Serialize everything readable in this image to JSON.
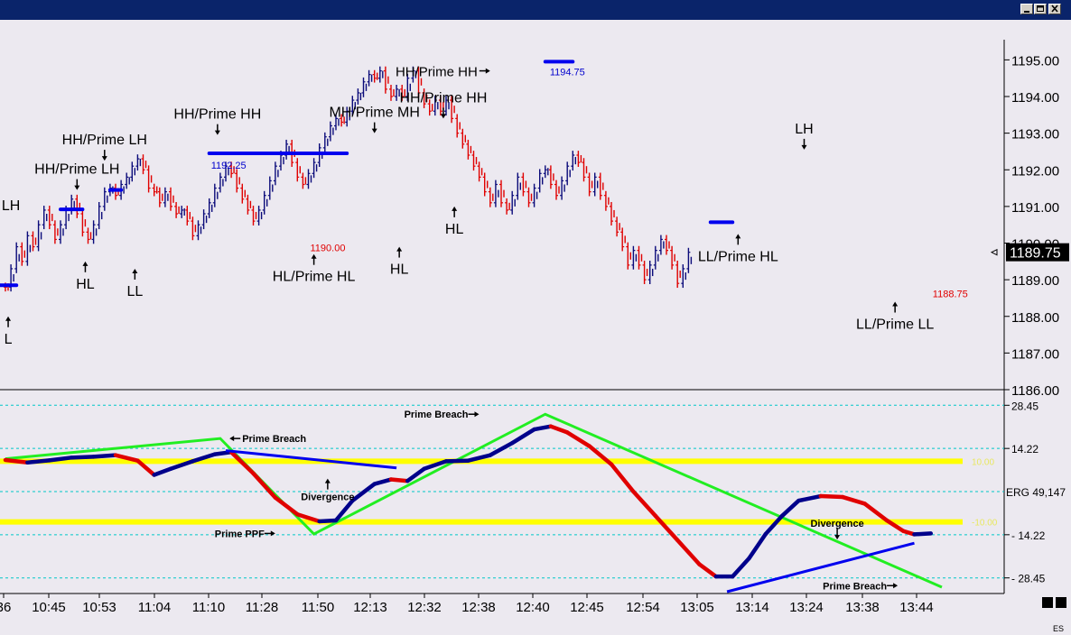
{
  "window": {
    "buttons": [
      "minimize",
      "maximize",
      "close"
    ]
  },
  "colors": {
    "background": "#ece9f0",
    "up_bar": "#0b0b7a",
    "down_bar": "#e00000",
    "level_bar": "#0000ee",
    "prime_line": "#22ee22",
    "reference_line": "#ffff00",
    "grid": "#00c8c8",
    "erg_up": "#00008b",
    "erg_down": "#e00000"
  },
  "chart_data": [
    {
      "type": "bar",
      "panel": "price",
      "symbol": "ES",
      "price_axis": {
        "ticks": [
          "1195.00",
          "1194.00",
          "1193.00",
          "1192.00",
          "1191.00",
          "1190.00",
          "1189.00",
          "1188.00",
          "1187.00",
          "1186.00"
        ],
        "range": [
          1186.0,
          1195.6
        ],
        "current_price": "1189.75"
      },
      "time_axis": {
        "ticks": [
          "36",
          "10:45",
          "10:53",
          "11:04",
          "11:10",
          "11:28",
          "11:50",
          "12:13",
          "12:32",
          "12:38",
          "12:40",
          "12:45",
          "12:54",
          "13:05",
          "13:14",
          "13:24",
          "13:38",
          "13:44"
        ]
      },
      "price_path": [
        [
          0,
          1188.8,
          -1
        ],
        [
          1,
          1189.3,
          1
        ],
        [
          2,
          1189.9,
          1
        ],
        [
          3,
          1189.5,
          -1
        ],
        [
          4,
          1190.2,
          1
        ],
        [
          5,
          1189.9,
          -1
        ],
        [
          6,
          1190.5,
          1
        ],
        [
          7,
          1190.9,
          1
        ],
        [
          8,
          1190.5,
          -1
        ],
        [
          9,
          1190.1,
          -1
        ],
        [
          10,
          1190.5,
          1
        ],
        [
          11,
          1190.9,
          1
        ],
        [
          12,
          1191.2,
          1
        ],
        [
          13,
          1190.8,
          -1
        ],
        [
          14,
          1190.3,
          -1
        ],
        [
          15,
          1190.1,
          -1
        ],
        [
          16,
          1190.5,
          1
        ],
        [
          17,
          1191.0,
          1
        ],
        [
          18,
          1191.4,
          1
        ],
        [
          19,
          1191.5,
          1
        ],
        [
          20,
          1191.3,
          -1
        ],
        [
          21,
          1191.6,
          1
        ],
        [
          22,
          1191.8,
          1
        ],
        [
          23,
          1192.1,
          1
        ],
        [
          24,
          1192.3,
          1
        ],
        [
          25,
          1192.0,
          -1
        ],
        [
          26,
          1191.5,
          -1
        ],
        [
          27,
          1191.4,
          -1
        ],
        [
          28,
          1191.1,
          -1
        ],
        [
          29,
          1191.4,
          1
        ],
        [
          30,
          1191.0,
          -1
        ],
        [
          31,
          1190.8,
          -1
        ],
        [
          32,
          1190.9,
          1
        ],
        [
          33,
          1190.6,
          -1
        ],
        [
          34,
          1190.2,
          -1
        ],
        [
          35,
          1190.5,
          1
        ],
        [
          36,
          1190.8,
          1
        ],
        [
          37,
          1191.1,
          1
        ],
        [
          38,
          1191.5,
          1
        ],
        [
          39,
          1191.8,
          1
        ],
        [
          40,
          1192.1,
          1
        ],
        [
          41,
          1191.9,
          -1
        ],
        [
          42,
          1191.5,
          -1
        ],
        [
          43,
          1191.2,
          -1
        ],
        [
          44,
          1190.9,
          -1
        ],
        [
          45,
          1190.6,
          -1
        ],
        [
          46,
          1190.9,
          1
        ],
        [
          47,
          1191.3,
          1
        ],
        [
          48,
          1191.7,
          1
        ],
        [
          49,
          1192.1,
          1
        ],
        [
          50,
          1192.4,
          1
        ],
        [
          51,
          1192.7,
          1
        ],
        [
          52,
          1192.2,
          -1
        ],
        [
          53,
          1191.8,
          -1
        ],
        [
          54,
          1191.6,
          -1
        ],
        [
          55,
          1191.9,
          1
        ],
        [
          56,
          1192.2,
          1
        ],
        [
          57,
          1192.6,
          1
        ],
        [
          58,
          1192.9,
          1
        ],
        [
          59,
          1193.2,
          1
        ],
        [
          60,
          1193.4,
          1
        ],
        [
          61,
          1193.3,
          -1
        ],
        [
          62,
          1193.6,
          1
        ],
        [
          63,
          1193.9,
          1
        ],
        [
          64,
          1194.1,
          1
        ],
        [
          65,
          1194.4,
          1
        ],
        [
          66,
          1194.6,
          1
        ],
        [
          67,
          1194.5,
          -1
        ],
        [
          68,
          1194.7,
          1
        ],
        [
          69,
          1194.2,
          -1
        ],
        [
          70,
          1194.0,
          -1
        ],
        [
          71,
          1194.2,
          1
        ],
        [
          72,
          1194.0,
          -1
        ],
        [
          73,
          1194.5,
          1
        ],
        [
          74,
          1194.7,
          1
        ],
        [
          75,
          1194.1,
          -1
        ],
        [
          76,
          1193.8,
          -1
        ],
        [
          77,
          1193.6,
          -1
        ],
        [
          78,
          1193.9,
          1
        ],
        [
          79,
          1193.6,
          -1
        ],
        [
          80,
          1193.9,
          1
        ],
        [
          81,
          1193.4,
          -1
        ],
        [
          82,
          1193.0,
          -1
        ],
        [
          83,
          1192.7,
          -1
        ],
        [
          84,
          1192.4,
          -1
        ],
        [
          85,
          1192.1,
          -1
        ],
        [
          86,
          1191.8,
          -1
        ],
        [
          87,
          1191.4,
          -1
        ],
        [
          88,
          1191.1,
          -1
        ],
        [
          89,
          1191.6,
          1
        ],
        [
          90,
          1191.1,
          -1
        ],
        [
          91,
          1190.9,
          -1
        ],
        [
          92,
          1191.3,
          1
        ],
        [
          93,
          1191.8,
          1
        ],
        [
          94,
          1191.4,
          -1
        ],
        [
          95,
          1191.1,
          -1
        ],
        [
          96,
          1191.5,
          1
        ],
        [
          97,
          1191.9,
          1
        ],
        [
          98,
          1192.0,
          1
        ],
        [
          99,
          1191.6,
          -1
        ],
        [
          100,
          1191.3,
          -1
        ],
        [
          101,
          1191.7,
          1
        ],
        [
          102,
          1192.1,
          1
        ],
        [
          103,
          1192.4,
          1
        ],
        [
          104,
          1192.2,
          -1
        ],
        [
          105,
          1191.8,
          -1
        ],
        [
          106,
          1191.4,
          -1
        ],
        [
          107,
          1191.8,
          1
        ],
        [
          108,
          1191.3,
          -1
        ],
        [
          109,
          1191.0,
          -1
        ],
        [
          110,
          1190.6,
          -1
        ],
        [
          111,
          1190.3,
          -1
        ],
        [
          112,
          1189.9,
          -1
        ],
        [
          113,
          1189.4,
          -1
        ],
        [
          114,
          1189.8,
          1
        ],
        [
          115,
          1189.4,
          -1
        ],
        [
          116,
          1189.0,
          -1
        ],
        [
          117,
          1189.4,
          1
        ],
        [
          118,
          1189.8,
          1
        ],
        [
          119,
          1190.1,
          1
        ],
        [
          120,
          1189.8,
          -1
        ],
        [
          121,
          1189.4,
          -1
        ],
        [
          122,
          1188.9,
          -1
        ],
        [
          123,
          1189.3,
          1
        ],
        [
          124,
          1189.75,
          1
        ]
      ],
      "levels": [
        {
          "x0": -2,
          "x1": 2,
          "price": 1188.85
        },
        {
          "x0": 10,
          "x1": 14,
          "price": 1190.92
        },
        {
          "x0": 19,
          "x1": 21,
          "price": 1191.45
        },
        {
          "x0": 37,
          "x1": 62,
          "price": 1192.45
        },
        {
          "x0": 98,
          "x1": 103,
          "price": 1194.95
        },
        {
          "x0": 128,
          "x1": 132,
          "price": 1190.57
        }
      ],
      "price_labels": [
        {
          "text": "1192.25",
          "bar": 37,
          "price": 1192.15,
          "color": "#0000cc"
        },
        {
          "text": "1190.00",
          "bar": 55,
          "price": 1189.9,
          "color": "#e00000"
        },
        {
          "text": "1194.75",
          "bar": 98.5,
          "price": 1194.7,
          "color": "#0000cc"
        },
        {
          "text": "1188.75",
          "bar": 168,
          "price": 1188.65,
          "color": "#e00000"
        }
      ],
      "annotations": [
        {
          "text": "LH",
          "bar": 1,
          "price": 1191.05,
          "arrow": "none"
        },
        {
          "text": "L",
          "bar": 0.5,
          "price": 1188.0,
          "arrow": "up"
        },
        {
          "text": "HH/Prime LH",
          "bar": 13,
          "price": 1191.45,
          "arrow": "down"
        },
        {
          "text": "HH/Prime LH",
          "bar": 18,
          "price": 1192.25,
          "arrow": "down"
        },
        {
          "text": "HL",
          "bar": 14.5,
          "price": 1189.5,
          "arrow": "up"
        },
        {
          "text": "LL",
          "bar": 23.5,
          "price": 1189.3,
          "arrow": "up"
        },
        {
          "text": "HH/Prime HH",
          "bar": 38.5,
          "price": 1192.95,
          "arrow": "down"
        },
        {
          "text": "HL/Prime HL",
          "bar": 56,
          "price": 1189.7,
          "arrow": "up"
        },
        {
          "text": "MH/Prime MH",
          "bar": 67,
          "price": 1193.0,
          "arrow": "down"
        },
        {
          "text": "HL",
          "bar": 71.5,
          "price": 1189.9,
          "arrow": "up"
        },
        {
          "text": "HH/Prime HH",
          "bar": 79.5,
          "price": 1193.4,
          "arrow": "down"
        },
        {
          "text": "HL",
          "bar": 81.5,
          "price": 1191.0,
          "arrow": "up"
        },
        {
          "text": "HH/Prime HH",
          "bar": 88,
          "price": 1194.7,
          "arrow": "right"
        },
        {
          "text": "LH",
          "bar": 145,
          "price": 1192.55,
          "arrow": "down"
        },
        {
          "text": "LL/Prime HL",
          "bar": 133,
          "price": 1190.25,
          "arrow": "up"
        },
        {
          "text": "LL/Prime LL",
          "bar": 161.5,
          "price": 1188.4,
          "arrow": "up"
        }
      ]
    },
    {
      "type": "line",
      "panel": "ERG",
      "label": "ERG 49,147",
      "axis_ticks": [
        "28.45",
        "14.22",
        "- 14.22",
        "- 28.45"
      ],
      "range": [
        -33,
        33
      ],
      "reference_lines": [
        {
          "value": 10.0,
          "label": "10.00"
        },
        {
          "value": -10.0,
          "label": "-10.00"
        }
      ],
      "series": [
        {
          "values": [
            [
              0,
              10.4
            ],
            [
              4,
              9.6
            ],
            [
              8,
              10.3
            ],
            [
              12,
              11.2
            ],
            [
              16,
              11.5
            ],
            [
              20,
              12.0
            ],
            [
              24,
              10.2
            ],
            [
              27,
              5.5
            ],
            [
              30,
              7.5
            ],
            [
              34,
              10.0
            ],
            [
              38,
              12.3
            ],
            [
              41,
              13.0
            ],
            [
              45,
              6.0
            ],
            [
              49,
              -2.0
            ],
            [
              53,
              -7.5
            ],
            [
              57,
              -9.8
            ],
            [
              60,
              -9.5
            ],
            [
              63,
              -3.0
            ],
            [
              67,
              2.5
            ],
            [
              70,
              4.0
            ],
            [
              73,
              3.5
            ],
            [
              76,
              7.5
            ],
            [
              80,
              10.0
            ],
            [
              84,
              10.2
            ],
            [
              88,
              12.0
            ],
            [
              92,
              16.0
            ],
            [
              96,
              20.5
            ],
            [
              99,
              21.5
            ],
            [
              102,
              19.5
            ],
            [
              106,
              15.0
            ],
            [
              110,
              9.0
            ],
            [
              114,
              0.0
            ],
            [
              118,
              -8.0
            ],
            [
              122,
              -16.0
            ],
            [
              126,
              -24.0
            ],
            [
              129,
              -28.0
            ],
            [
              132,
              -28.0
            ],
            [
              135,
              -22.0
            ],
            [
              138,
              -14.0
            ],
            [
              141,
              -8.0
            ],
            [
              144,
              -3.0
            ],
            [
              148,
              -1.5
            ],
            [
              152,
              -1.8
            ],
            [
              156,
              -4.0
            ],
            [
              160,
              -9.5
            ],
            [
              163,
              -13.0
            ],
            [
              165,
              -14.1
            ],
            [
              168,
              -13.8
            ]
          ]
        }
      ],
      "overlays": [
        {
          "name": "prime-line-1",
          "color": "#22ee22",
          "points": [
            [
              0,
              10.8
            ],
            [
              39,
              17.5
            ],
            [
              56,
              -14.0
            ],
            [
              98,
              25.5
            ],
            [
              170,
              -31.5
            ]
          ]
        },
        {
          "name": "divergence-line-1",
          "color": "#0000ee",
          "points": [
            [
              40,
              13.5
            ],
            [
              71,
              7.8
            ]
          ]
        },
        {
          "name": "divergence-line-2",
          "color": "#0000ee",
          "points": [
            [
              131,
              -33.0
            ],
            [
              165,
              -17.0
            ]
          ]
        }
      ],
      "annotations": [
        {
          "text": "Prime Breach",
          "bar": 42,
          "value": 17.5,
          "arrow": "left"
        },
        {
          "text": "Divergence",
          "bar": 58.5,
          "value": 2.5,
          "arrow": "up"
        },
        {
          "text": "Prime PPF",
          "bar": 48,
          "value": -13.8,
          "arrow": "right"
        },
        {
          "text": "Prime Breach",
          "bar": 85,
          "value": 25.5,
          "arrow": "right"
        },
        {
          "text": "Divergence",
          "bar": 151,
          "value": -14.0,
          "arrow": "down"
        },
        {
          "text": "Prime Breach",
          "bar": 161,
          "value": -31.0,
          "arrow": "right"
        }
      ]
    }
  ]
}
